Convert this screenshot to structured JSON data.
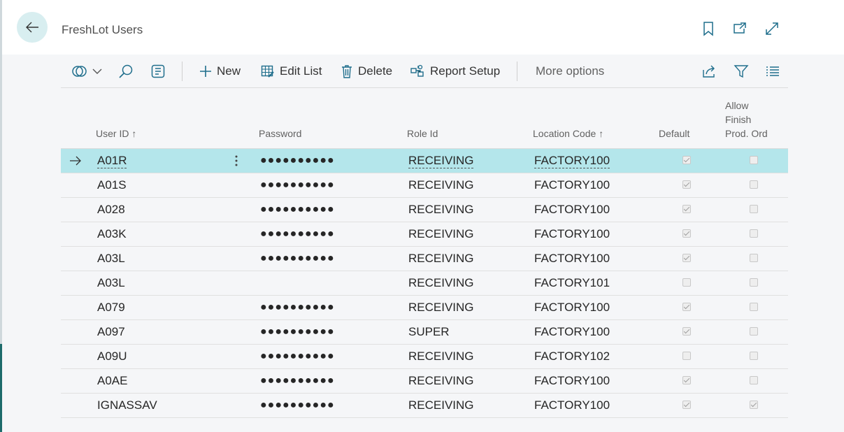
{
  "page": {
    "title": "FreshLot Users"
  },
  "toolbar": {
    "new_label": "New",
    "edit_list_label": "Edit List",
    "delete_label": "Delete",
    "report_setup_label": "Report Setup",
    "more_options_label": "More options"
  },
  "columns": {
    "user_id": "User ID",
    "password": "Password",
    "role_id": "Role Id",
    "location_code": "Location Code",
    "default": "Default",
    "allow_finish_line1": "Allow",
    "allow_finish_line2": "Finish",
    "allow_finish_line3": "Prod. Ord",
    "sort_arrow": "↑"
  },
  "rows": [
    {
      "user_id": "A01R",
      "password": "●●●●●●●●●●",
      "role_id": "RECEIVING",
      "location_code": "FACTORY100",
      "default": true,
      "allow_finish": false,
      "selected": true
    },
    {
      "user_id": "A01S",
      "password": "●●●●●●●●●●",
      "role_id": "RECEIVING",
      "location_code": "FACTORY100",
      "default": true,
      "allow_finish": false
    },
    {
      "user_id": "A028",
      "password": "●●●●●●●●●●",
      "role_id": "RECEIVING",
      "location_code": "FACTORY100",
      "default": true,
      "allow_finish": false
    },
    {
      "user_id": "A03K",
      "password": "●●●●●●●●●●",
      "role_id": "RECEIVING",
      "location_code": "FACTORY100",
      "default": true,
      "allow_finish": false
    },
    {
      "user_id": "A03L",
      "password": "●●●●●●●●●●",
      "role_id": "RECEIVING",
      "location_code": "FACTORY100",
      "default": true,
      "allow_finish": false
    },
    {
      "user_id": "A03L",
      "password": "",
      "role_id": "RECEIVING",
      "location_code": "FACTORY101",
      "default": false,
      "allow_finish": false
    },
    {
      "user_id": "A079",
      "password": "●●●●●●●●●●",
      "role_id": "RECEIVING",
      "location_code": "FACTORY100",
      "default": true,
      "allow_finish": false
    },
    {
      "user_id": "A097",
      "password": "●●●●●●●●●●",
      "role_id": "SUPER",
      "location_code": "FACTORY100",
      "default": true,
      "allow_finish": false
    },
    {
      "user_id": "A09U",
      "password": "●●●●●●●●●●",
      "role_id": "RECEIVING",
      "location_code": "FACTORY102",
      "default": false,
      "allow_finish": false
    },
    {
      "user_id": "A0AE",
      "password": "●●●●●●●●●●",
      "role_id": "RECEIVING",
      "location_code": "FACTORY100",
      "default": true,
      "allow_finish": false
    },
    {
      "user_id": "IGNASSAV",
      "password": "●●●●●●●●●●",
      "role_id": "RECEIVING",
      "location_code": "FACTORY100",
      "default": true,
      "allow_finish": true
    }
  ],
  "colors": {
    "accent": "#1f6e8c",
    "selected_row": "#b4e6eb",
    "back_button": "#d8eef0"
  }
}
